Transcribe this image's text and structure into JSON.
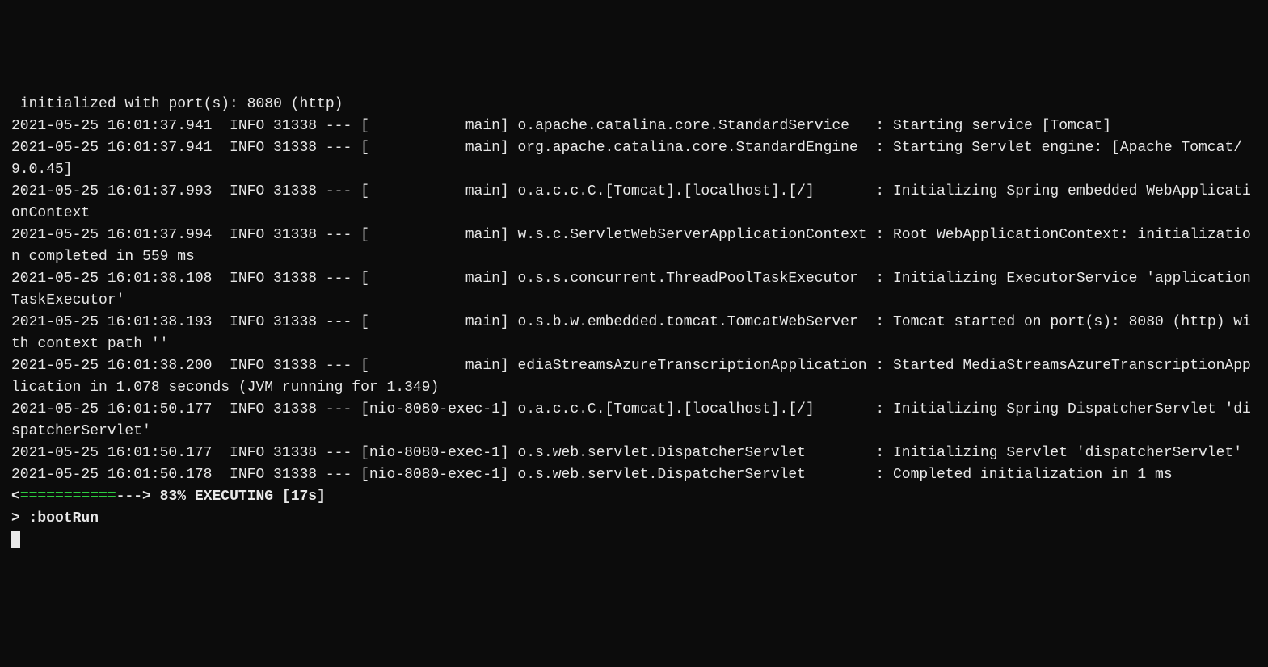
{
  "log": {
    "line0": " initialized with port(s): 8080 (http)",
    "line1": "2021-05-25 16:01:37.941  INFO 31338 --- [           main] o.apache.catalina.core.StandardService   : Starting service [Tomcat]",
    "line2": "2021-05-25 16:01:37.941  INFO 31338 --- [           main] org.apache.catalina.core.StandardEngine  : Starting Servlet engine: [Apache Tomcat/9.0.45]",
    "line3": "2021-05-25 16:01:37.993  INFO 31338 --- [           main] o.a.c.c.C.[Tomcat].[localhost].[/]       : Initializing Spring embedded WebApplicationContext",
    "line4": "2021-05-25 16:01:37.994  INFO 31338 --- [           main] w.s.c.ServletWebServerApplicationContext : Root WebApplicationContext: initialization completed in 559 ms",
    "line5": "2021-05-25 16:01:38.108  INFO 31338 --- [           main] o.s.s.concurrent.ThreadPoolTaskExecutor  : Initializing ExecutorService 'applicationTaskExecutor'",
    "line6": "2021-05-25 16:01:38.193  INFO 31338 --- [           main] o.s.b.w.embedded.tomcat.TomcatWebServer  : Tomcat started on port(s): 8080 (http) with context path ''",
    "line7": "2021-05-25 16:01:38.200  INFO 31338 --- [           main] ediaStreamsAzureTranscriptionApplication : Started MediaStreamsAzureTranscriptionApplication in 1.078 seconds (JVM running for 1.349)",
    "line8": "2021-05-25 16:01:50.177  INFO 31338 --- [nio-8080-exec-1] o.a.c.c.C.[Tomcat].[localhost].[/]       : Initializing Spring DispatcherServlet 'dispatcherServlet'",
    "line9": "2021-05-25 16:01:50.177  INFO 31338 --- [nio-8080-exec-1] o.s.web.servlet.DispatcherServlet        : Initializing Servlet 'dispatcherServlet'",
    "line10": "2021-05-25 16:01:50.178  INFO 31338 --- [nio-8080-exec-1] o.s.web.servlet.DispatcherServlet        : Completed initialization in 1 ms"
  },
  "progress": {
    "open": "<",
    "filled": "===========",
    "empty": "--->",
    "text": " 83% EXECUTING [17s]"
  },
  "task": {
    "line": "> :bootRun"
  }
}
